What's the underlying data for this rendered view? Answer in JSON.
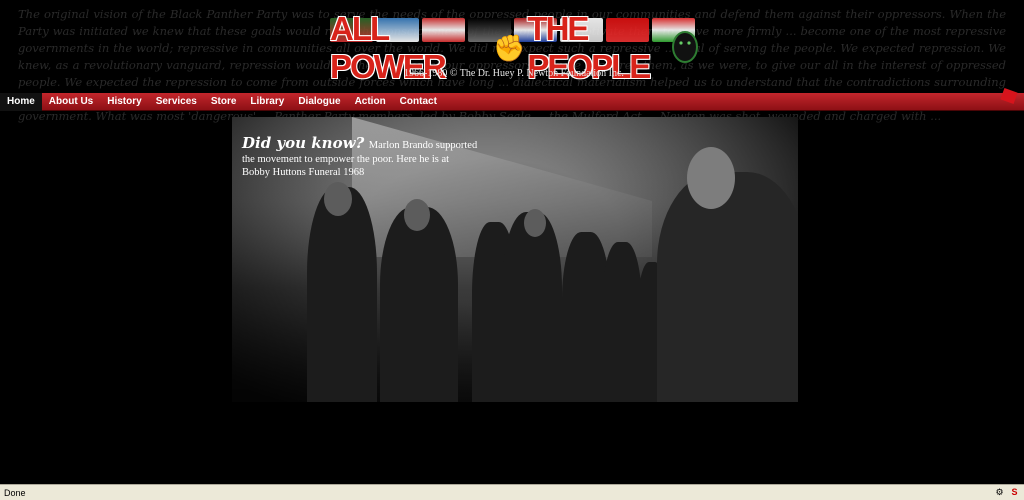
{
  "background_text": "The original vision of the Black Panther Party was to serve the needs of the oppressed people in our communities and defend them against their oppressors. When the Party was initiated we knew that these goals would raise the consciousness of the people and motivate them to move more firmly ... become one of the most repressive governments in the world; repressive in communities all over the world. We did not expect such a repressive ... goal of serving the people. We expected repression. We knew, as a revolutionary vanguard, repression would be the reaction of our oppressors ... were prepared them, as we were, to give our all in the interest of oppressed people. We expected the repression to come from outside forces which have long ... dialectical materialism helped us to understand that the contradictions surrounding ... all the Party would survive. It was against this ... forms of oppression of blacks and offering revolution as an option. At the same time, the Black ... the U.S. government. What was most 'dangerous' ... Panther Party members, led by Bobby Seale ... the Mulford Act ... Newton was shot, wounded and charged with ...",
  "header": {
    "logo_left": "ALL POWER",
    "logo_right": "THE PEOPLE",
    "foundation": "1966-1980 © The Dr. Huey P. Newton Foundation Inc."
  },
  "nav": [
    {
      "label": "Home",
      "active": true
    },
    {
      "label": "About Us"
    },
    {
      "label": "History"
    },
    {
      "label": "Services"
    },
    {
      "label": "Store"
    },
    {
      "label": "Library"
    },
    {
      "label": "Dialogue"
    },
    {
      "label": "Action"
    },
    {
      "label": "Contact"
    }
  ],
  "did_you_know": {
    "title": "Did you know?",
    "line1": "Marlon Brando supported",
    "line2": "the movement to empower the poor.  Here he is at",
    "line3": "Bobby Huttons Funeral 1968"
  },
  "status": {
    "text": "Done"
  },
  "colors": {
    "nav_red": "#c3262c",
    "logo_red": "#d8231a"
  }
}
